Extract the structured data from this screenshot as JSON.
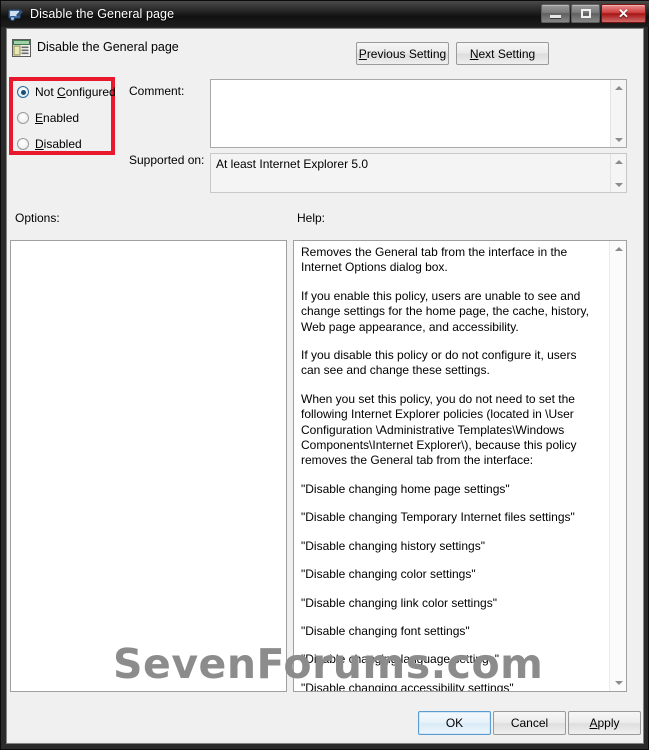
{
  "window": {
    "title": "Disable the General page",
    "icon": "group-policy-icon",
    "controls": {
      "minimize": "minimize-icon",
      "maximize": "maximize-icon",
      "close": "✕"
    }
  },
  "header": {
    "icon": "policy-setting-icon",
    "title": "Disable the General page",
    "previous_setting": "Previous Setting",
    "previous_accel": "P",
    "next_setting": "Next Setting",
    "next_accel": "N"
  },
  "state_group": {
    "highlight_color": "#e8192c",
    "options": [
      {
        "label_before": "Not ",
        "accel": "C",
        "label_after": "onfigured",
        "checked": true,
        "name": "not-configured"
      },
      {
        "label_before": "",
        "accel": "E",
        "label_after": "nabled",
        "checked": false,
        "name": "enabled"
      },
      {
        "label_before": "",
        "accel": "D",
        "label_after": "isabled",
        "checked": false,
        "name": "disabled"
      }
    ]
  },
  "fields": {
    "comment_label": "Comment:",
    "comment_value": "",
    "supported_label": "Supported on:",
    "supported_value": "At least Internet Explorer 5.0"
  },
  "sections": {
    "options_label": "Options:",
    "help_label": "Help:"
  },
  "help": {
    "paragraphs": [
      "Removes the General tab from the interface in the Internet Options dialog box.",
      "If you enable this policy, users are unable to see and change settings for the home page, the cache, history, Web page appearance, and accessibility.",
      "If you disable this policy or do not configure it, users can see and change these settings.",
      "When you set this policy, you do not need to set the following Internet Explorer policies (located in \\User Configuration \\Administrative Templates\\Windows Components\\Internet Explorer\\), because this policy removes the General tab from the interface:",
      "\"Disable changing home page settings\"",
      "\"Disable changing Temporary Internet files settings\"",
      "\"Disable changing history settings\"",
      "\"Disable changing color settings\"",
      "\"Disable changing link color settings\"",
      "\"Disable changing font settings\"",
      "\"Disable changing language settings\"",
      "\"Disable changing accessibility settings\""
    ]
  },
  "actions": {
    "ok": "OK",
    "cancel": "Cancel",
    "apply_before": "",
    "apply_accel": "A",
    "apply_after": "pply"
  },
  "watermark": "SevenForums.com"
}
